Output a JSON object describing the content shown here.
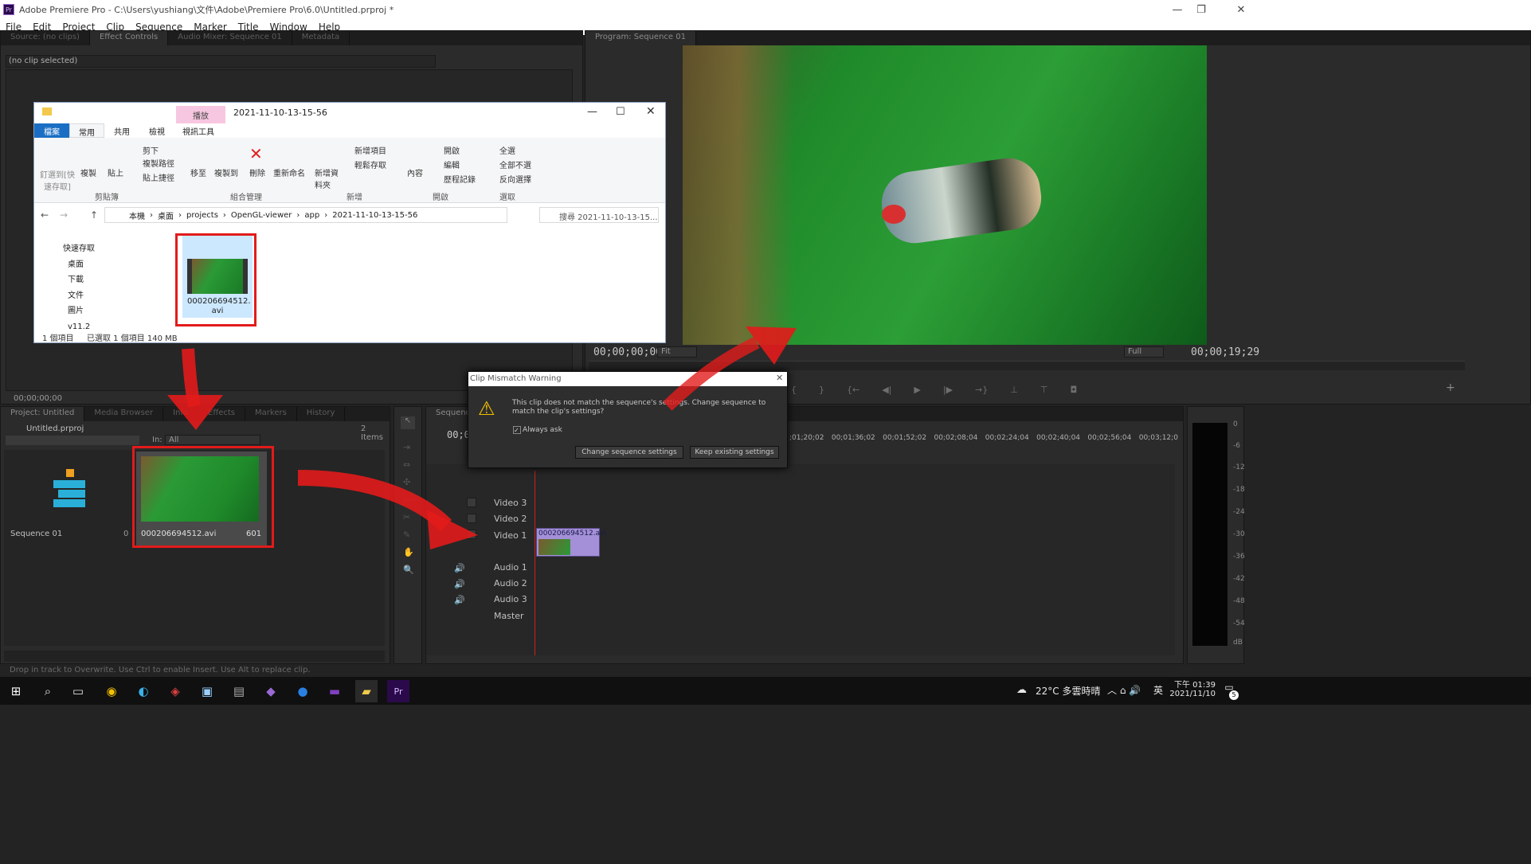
{
  "window": {
    "title": "Adobe Premiere Pro - C:\\Users\\yushiang\\文件\\Adobe\\Premiere Pro\\6.0\\Untitled.prproj *",
    "min": "—",
    "max": "❐",
    "close": "✕"
  },
  "menu": [
    "File",
    "Edit",
    "Project",
    "Clip",
    "Sequence",
    "Marker",
    "Title",
    "Window",
    "Help"
  ],
  "source_panel": {
    "tabs": [
      "Source: (no clips)",
      "Effect Controls",
      "Audio Mixer: Sequence 01",
      "Metadata"
    ],
    "no_clip": "(no clip selected)",
    "timecode": "00;00;00;00"
  },
  "program": {
    "tab": "Program: Sequence 01",
    "timecode_left": "00;00;00;00",
    "fit": "Fit",
    "timecode_right": "00;00;19;29",
    "full": "Full"
  },
  "project": {
    "tabs": [
      "Project: Untitled",
      "Media Browser",
      "Info",
      "Effects",
      "Markers",
      "History"
    ],
    "name": "Untitled.prproj",
    "count": "2 Items",
    "in_label": "In:",
    "in_value": "All",
    "items": [
      {
        "name": "Sequence 01",
        "duration": "0"
      },
      {
        "name": "000206694512.avi",
        "duration": "601"
      }
    ]
  },
  "timeline": {
    "tab": "Sequence 01",
    "timecode": "00;00",
    "ruler": [
      ";01;20;02",
      "00;01;36;02",
      "00;01;52;02",
      "00;02;08;04",
      "00;02;24;04",
      "00;02;40;04",
      "00;02;56;04",
      "00;03;12;0"
    ],
    "tracks": [
      "Video 3",
      "Video 2",
      "Video 1",
      "Audio 1",
      "Audio 2",
      "Audio 3",
      "Master"
    ],
    "clip": "000206694512.avi"
  },
  "meters": [
    "0",
    "-6",
    "-12",
    "-18",
    "-24",
    "-30",
    "-36",
    "-42",
    "-48",
    "-54",
    "dB"
  ],
  "status": "Drop in track to Overwrite. Use Ctrl to enable Insert. Use Alt to replace clip.",
  "dialog": {
    "title": "Clip Mismatch Warning",
    "message": "This clip does not match the sequence's settings. Change sequence to match the clip's settings?",
    "checkbox": "Always ask",
    "change": "Change sequence settings",
    "keep": "Keep existing settings"
  },
  "explorer": {
    "title": "2021-11-10-13-15-56",
    "play_tab": "播放",
    "tabs": [
      "檔案",
      "常用",
      "共用",
      "檢視",
      "視訊工具"
    ],
    "ribbon": {
      "pin": "釘選到[快速存取]",
      "copy": "複製",
      "paste": "貼上",
      "cut": "剪下",
      "copypath": "複製路徑",
      "pasteshort": "貼上捷徑",
      "moveto": "移至",
      "copyto": "複製到",
      "delete": "刪除",
      "rename": "重新命名",
      "newfolder": "新增資料夾",
      "newitem": "新增項目",
      "easyaccess": "輕鬆存取",
      "props": "內容",
      "open": "開啟",
      "edit": "編輯",
      "history": "歷程記錄",
      "selall": "全選",
      "selnone": "全部不選",
      "selinv": "反向選擇",
      "groups": [
        "剪貼簿",
        "組合管理",
        "新增",
        "開啟",
        "選取"
      ]
    },
    "path": [
      "本機",
      "桌面",
      "projects",
      "OpenGL-viewer",
      "app",
      "2021-11-10-13-15-56"
    ],
    "search": "搜尋 2021-11-10-13-15...",
    "nav": [
      "快速存取",
      "桌面",
      "下載",
      "文件",
      "圖片",
      "v11.2"
    ],
    "file": "000206694512.avi",
    "file_line1": "000206694512.",
    "file_line2": "avi",
    "status": [
      "1 個項目",
      "已選取 1 個項目 140 MB"
    ]
  },
  "taskbar": {
    "weather": "22°C 多雲時晴",
    "time": "下午 01:39",
    "date": "2021/11/10",
    "ime": "英",
    "notif": "5"
  }
}
